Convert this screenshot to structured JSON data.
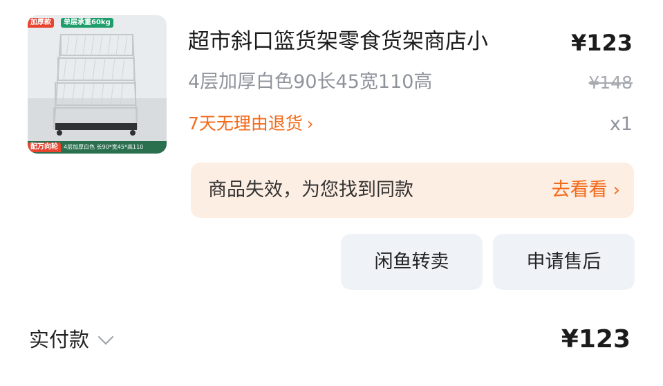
{
  "product": {
    "image": {
      "tag_thick": "加厚款",
      "tag_load": "单层承重60kg",
      "tag_wheel": "配万向轮",
      "spec_caption": "4层加厚白色  长90*宽45*高110"
    },
    "title": "超市斜口篮货架零食货架商店小",
    "price": "¥123",
    "spec": "4层加厚白色90长45宽110高",
    "original_price": "¥148",
    "return_policy": "7天无理由退货",
    "return_chevron": "›",
    "quantity": "x1"
  },
  "banner": {
    "text": "商品失效，为您找到同款",
    "link_label": "去看看",
    "link_chevron": "›"
  },
  "actions": {
    "resell_label": "闲鱼转卖",
    "after_sales_label": "申请售后"
  },
  "footer": {
    "paid_label": "实付款",
    "paid_amount": "¥123"
  },
  "colors": {
    "accent": "#f26a1b",
    "banner_bg": "#fdeee3",
    "button_bg": "#eff3f8",
    "muted_text": "#8f939b"
  }
}
